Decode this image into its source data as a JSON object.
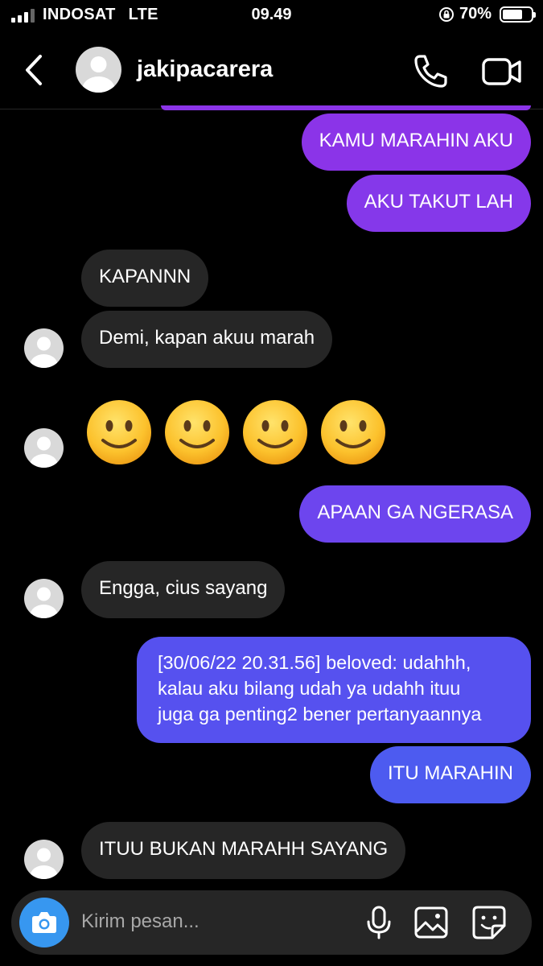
{
  "status_bar": {
    "carrier": "INDOSAT",
    "network": "LTE",
    "time": "09.49",
    "battery": "70%",
    "battery_level": 0.7
  },
  "header": {
    "username": "jakipacarera",
    "icons": [
      "back-chevron-icon",
      "avatar",
      "phone-icon",
      "video-camera-icon"
    ]
  },
  "messages": [
    {
      "from": "me",
      "text": "KAMU MARAHIN AKU"
    },
    {
      "from": "me",
      "text": "AKU TAKUT LAH"
    },
    {
      "from": "them",
      "text": "KAPANNN"
    },
    {
      "from": "them",
      "text": "Demi, kapan akuu marah"
    },
    {
      "from": "them",
      "type": "emoji",
      "emoji": "slightly-smiling-face-icon",
      "count": 4
    },
    {
      "from": "me",
      "text": "APAAN GA NGERASA"
    },
    {
      "from": "them",
      "text": "Engga, cius sayang"
    },
    {
      "from": "me",
      "lines": [
        "[30/06/22 20.31.56] beloved: udahhh,",
        "kalau aku bilang udah ya udahh ituu",
        "juga ga penting2 bener pertanyaannya"
      ]
    },
    {
      "from": "me",
      "text": "ITU MARAHIN"
    },
    {
      "from": "them",
      "text": "ITUU BUKAN MARAHH SAYANG"
    }
  ],
  "composer": {
    "placeholder": "Kirim pesan...",
    "icons": [
      "camera-icon",
      "microphone-icon",
      "gallery-icon",
      "sticker-icon"
    ]
  },
  "colors": {
    "outgoing_top": "#8b34e8",
    "outgoing_bottom": "#4d5bf0",
    "incoming": "#262626",
    "camera_button": "#3797f0"
  }
}
